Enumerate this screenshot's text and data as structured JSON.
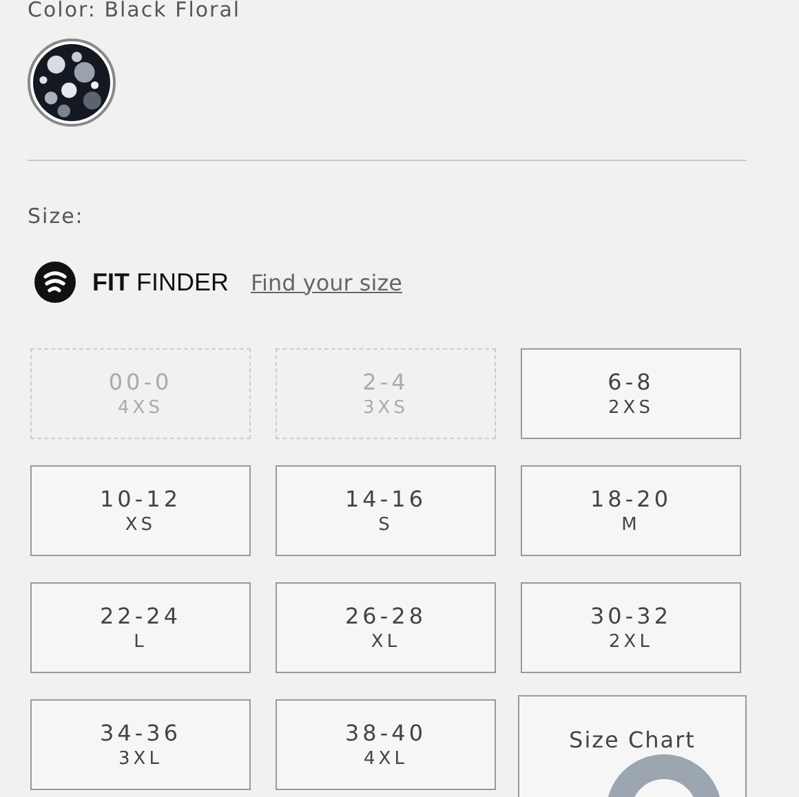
{
  "color_label": "Color: Black Floral",
  "swatches": [
    {
      "kind": "picture",
      "selected": true
    }
  ],
  "size_label": "Size:",
  "fit_finder": {
    "logo": "**FIT** FINDER",
    "link": "Find your size"
  },
  "sizes": [
    {
      "kind": "size",
      "range": "00-0",
      "letter": "4XS",
      "disabled": true
    },
    {
      "kind": "size",
      "range": "2-4",
      "letter": "3XS",
      "disabled": true
    },
    {
      "kind": "size",
      "range": "6-8",
      "letter": "2XS",
      "disabled": false
    },
    {
      "kind": "size",
      "range": "10-12",
      "letter": "XS",
      "disabled": false
    },
    {
      "kind": "size",
      "range": "14-16",
      "letter": "S",
      "disabled": false
    },
    {
      "kind": "size",
      "range": "18-20",
      "letter": "M",
      "disabled": false
    },
    {
      "kind": "size",
      "range": "22-24",
      "letter": "L",
      "disabled": false
    },
    {
      "kind": "size",
      "range": "26-28",
      "letter": "XL",
      "disabled": false
    },
    {
      "kind": "size",
      "range": "30-32",
      "letter": "2XL",
      "disabled": false
    },
    {
      "kind": "size",
      "range": "34-36",
      "letter": "3XL",
      "disabled": false
    },
    {
      "kind": "size",
      "range": "38-40",
      "letter": "4XL",
      "disabled": false
    },
    {
      "kind": "link",
      "range": "Size Chart"
    }
  ]
}
